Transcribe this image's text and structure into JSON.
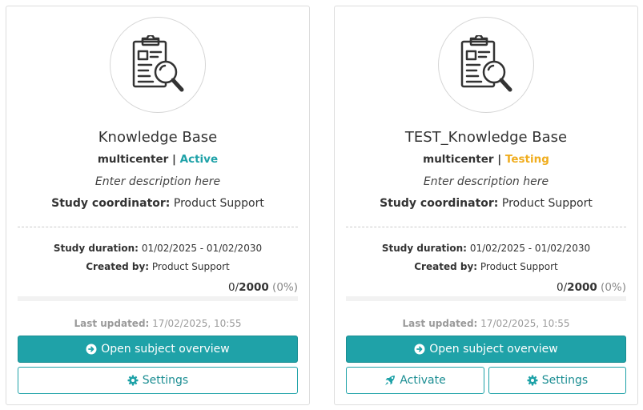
{
  "colors": {
    "accent": "#1fa2a8",
    "active_status": "#1fa2a8",
    "testing_status": "#f0ad1e"
  },
  "cards": [
    {
      "icon": "clipboard-search-icon",
      "title": "Knowledge Base",
      "type": "multicenter",
      "separator": "|",
      "status": "Active",
      "description": "Enter description here",
      "coordinator_label": "Study coordinator:",
      "coordinator": "Product Support",
      "duration_label": "Study duration:",
      "duration": "01/02/2025 - 01/02/2030",
      "created_label": "Created by:",
      "created_by": "Product Support",
      "count_current": "0",
      "count_slash": "/",
      "count_total": "2000",
      "count_percent": "(0%)",
      "progress": 0,
      "updated_label": "Last updated:",
      "updated": "17/02/2025, 10:55",
      "open_label": "Open subject overview",
      "settings_label": "Settings"
    },
    {
      "icon": "clipboard-search-icon",
      "title": "TEST_Knowledge Base",
      "type": "multicenter",
      "separator": "|",
      "status": "Testing",
      "description": "Enter description here",
      "coordinator_label": "Study coordinator:",
      "coordinator": "Product Support",
      "duration_label": "Study duration:",
      "duration": "01/02/2025 - 01/02/2030",
      "created_label": "Created by:",
      "created_by": "Product Support",
      "count_current": "0",
      "count_slash": "/",
      "count_total": "2000",
      "count_percent": "(0%)",
      "progress": 0,
      "updated_label": "Last updated:",
      "updated": "17/02/2025, 10:55",
      "open_label": "Open subject overview",
      "activate_label": "Activate",
      "settings_label": "Settings"
    }
  ]
}
